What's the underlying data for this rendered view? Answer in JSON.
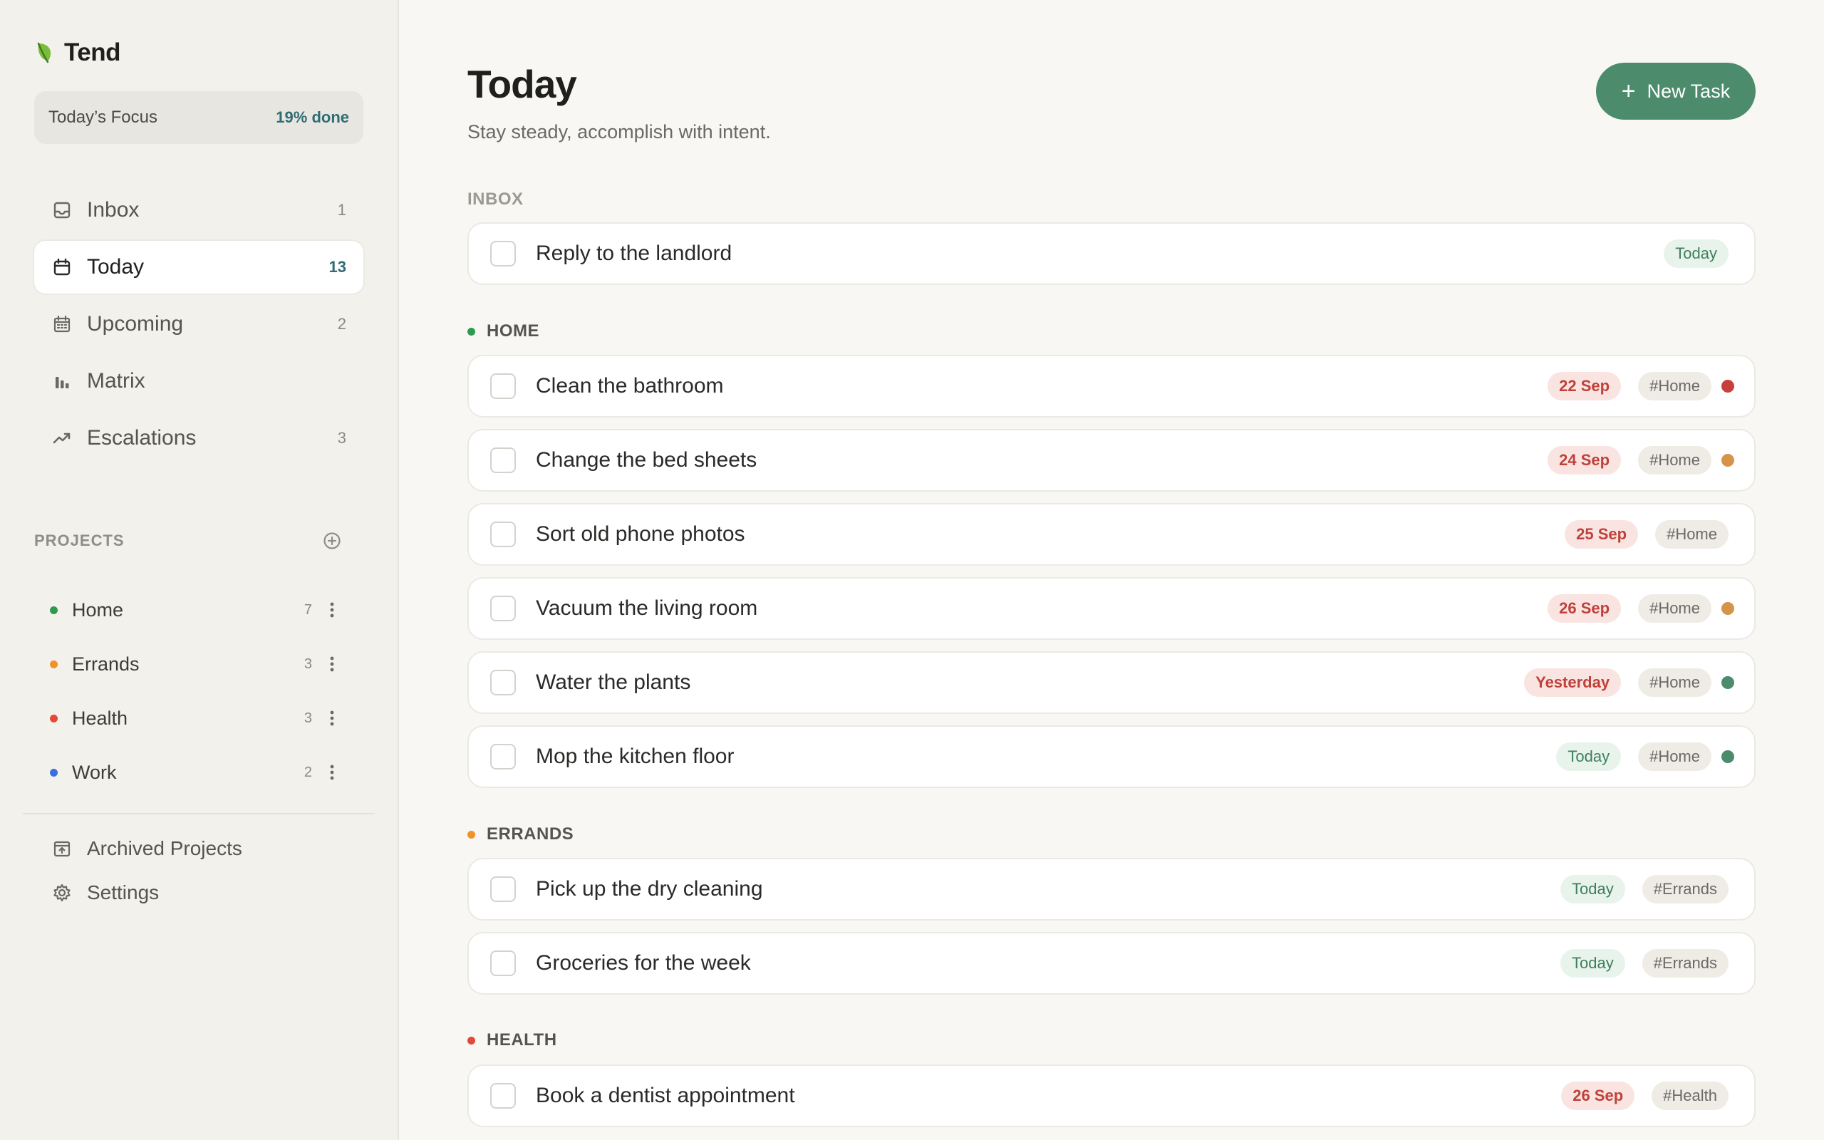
{
  "app": {
    "name": "Tend"
  },
  "focus": {
    "label": "Today’s Focus",
    "percent": "19% done"
  },
  "nav": [
    {
      "label": "Inbox",
      "count": "1",
      "icon": "inbox-icon"
    },
    {
      "label": "Today",
      "count": "13",
      "icon": "calendar-icon",
      "active": true
    },
    {
      "label": "Upcoming",
      "count": "2",
      "icon": "calendar-grid-icon"
    },
    {
      "label": "Matrix",
      "count": "",
      "icon": "bar-chart-icon"
    },
    {
      "label": "Escalations",
      "count": "3",
      "icon": "trend-up-icon"
    }
  ],
  "projects": {
    "heading": "PROJECTS",
    "items": [
      {
        "name": "Home",
        "count": "7",
        "color": "#2e9a4e"
      },
      {
        "name": "Errands",
        "count": "3",
        "color": "#f0922b"
      },
      {
        "name": "Health",
        "count": "3",
        "color": "#e04a3c"
      },
      {
        "name": "Work",
        "count": "2",
        "color": "#3b6fe0"
      }
    ]
  },
  "footer_links": [
    {
      "label": "Archived Projects",
      "icon": "archive-icon"
    },
    {
      "label": "Settings",
      "icon": "gear-icon"
    }
  ],
  "header": {
    "title": "Today",
    "subtitle": "Stay steady, accomplish with intent.",
    "new_task_label": "New Task"
  },
  "sections": {
    "inbox": {
      "title": "INBOX"
    },
    "home": {
      "title": "HOME",
      "color": "#2e9a4e"
    },
    "errands": {
      "title": "ERRANDS",
      "color": "#f0922b"
    },
    "health": {
      "title": "HEALTH",
      "color": "#e04a3c"
    }
  },
  "tasks": [
    {
      "title": "Reply to the landlord",
      "date": "Today",
      "date_kind": "today",
      "tag": "",
      "priority": ""
    },
    {
      "title": "Clean the bathroom",
      "date": "22 Sep",
      "date_kind": "overdue",
      "tag": "#Home",
      "priority": "#c9403a"
    },
    {
      "title": "Change the bed sheets",
      "date": "24 Sep",
      "date_kind": "overdue",
      "tag": "#Home",
      "priority": "#d6934a"
    },
    {
      "title": "Sort old phone photos",
      "date": "25 Sep",
      "date_kind": "overdue",
      "tag": "#Home",
      "priority": ""
    },
    {
      "title": "Vacuum the living room",
      "date": "26 Sep",
      "date_kind": "overdue",
      "tag": "#Home",
      "priority": "#d6934a"
    },
    {
      "title": "Water the plants",
      "date": "Yesterday",
      "date_kind": "overdue",
      "tag": "#Home",
      "priority": "#4c8c6c"
    },
    {
      "title": "Mop the kitchen floor",
      "date": "Today",
      "date_kind": "today",
      "tag": "#Home",
      "priority": "#4c8c6c"
    },
    {
      "title": "Pick up the dry cleaning",
      "date": "Today",
      "date_kind": "today",
      "tag": "#Errands",
      "priority": ""
    },
    {
      "title": "Groceries for the week",
      "date": "Today",
      "date_kind": "today",
      "tag": "#Errands",
      "priority": ""
    },
    {
      "title": "Book a dentist appointment",
      "date": "26 Sep",
      "date_kind": "overdue",
      "tag": "#Health",
      "priority": ""
    }
  ]
}
